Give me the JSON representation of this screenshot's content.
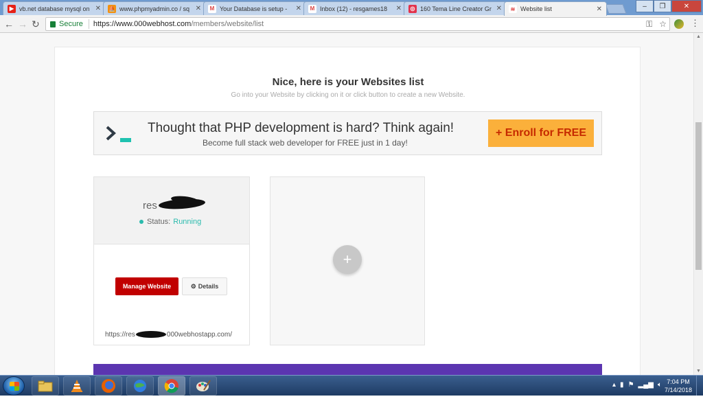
{
  "browser": {
    "tabs": [
      {
        "title": "vb.net database mysql on",
        "favicon": "youtube-icon",
        "color": "#e62117",
        "glyph": "▶"
      },
      {
        "title": "www.phpmyadmin.co / sq",
        "favicon": "phpmyadmin-icon",
        "color": "#f29111",
        "glyph": "⛵"
      },
      {
        "title": "Your Database is setup -",
        "favicon": "gmail-icon",
        "color": "#ffffff",
        "glyph": "M"
      },
      {
        "title": "Inbox (12) - resgames18",
        "favicon": "gmail-icon",
        "color": "#ffffff",
        "glyph": "M"
      },
      {
        "title": "160 Tema Line Creator Gr",
        "favicon": "line-creator-icon",
        "color": "#e2334c",
        "glyph": "◎"
      },
      {
        "title": "Website list",
        "favicon": "webhost-icon",
        "color": "#ffffff",
        "glyph": "≋",
        "active": true
      }
    ],
    "close_glyph": "✕",
    "address": {
      "secure_label": "Secure",
      "url_host": "https://www.000webhost.com",
      "url_path": "/members/website/list"
    }
  },
  "page": {
    "heading": "Nice, here is your Websites list",
    "subheading": "Go into your Website by clicking on it or click button to create a new Website.",
    "banner": {
      "title": "Thought that PHP development is hard? Think again!",
      "subtitle": "Become full stack web developer for FREE just in 1 day!",
      "cta": "+ Enroll for FREE"
    },
    "website": {
      "name_visible": "res",
      "status_label": "Status:",
      "status_value": "Running",
      "manage_label": "Manage Website",
      "details_label": "Details",
      "url_prefix": "https://res",
      "url_suffix": "000webhostapp.com/"
    },
    "add_card": {
      "glyph": "+"
    }
  },
  "taskbar": {
    "apps": [
      "file-explorer-icon",
      "vlc-icon",
      "firefox-icon",
      "network-globe-icon",
      "chrome-icon",
      "paint-icon"
    ],
    "clock_time": "7:04 PM",
    "clock_date": "7/14/2018"
  },
  "colors": {
    "accent_teal": "#2bbbad",
    "manage_red": "#c10000",
    "cta_orange": "#fbb03b",
    "purple_footer": "#5b35b0"
  }
}
